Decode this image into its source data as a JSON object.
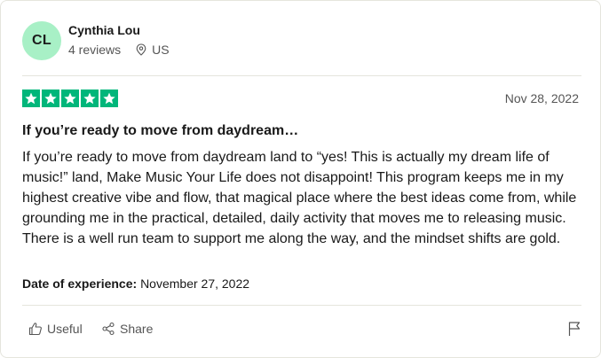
{
  "review": {
    "author": {
      "initials": "CL",
      "avatar_color": "#a8f0c6",
      "name": "Cynthia Lou",
      "reviews_count": "4 reviews",
      "country": "US"
    },
    "rating": 5,
    "star_color": "#00b67a",
    "date": "Nov 28, 2022",
    "title": "If you’re ready to move from daydream…",
    "body": "If you’re ready to move from daydream land to “yes! This is actually my dream life of music!” land, Make Music Your Life does not disappoint! This program keeps me in my highest creative vibe and flow, that magical place where the best ideas come from, while grounding me in the practical, detailed, daily activity that moves me to releasing music. There is a well run team to support me along the way, and the mindset shifts are gold.",
    "experience_label": "Date of experience:",
    "experience_date": "November 27, 2022"
  },
  "actions": {
    "useful_label": "Useful",
    "share_label": "Share",
    "useful_icon": "thumbs-up-icon",
    "share_icon": "share-icon",
    "flag_icon": "flag-icon"
  }
}
